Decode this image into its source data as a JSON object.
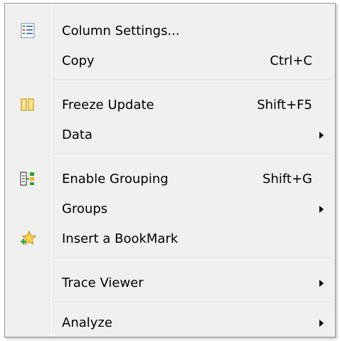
{
  "menu": {
    "items": [
      {
        "label": "Column Settings...",
        "shortcut": "",
        "icon": "column-settings-icon"
      },
      {
        "label": "Copy",
        "shortcut": "Ctrl+C"
      },
      {
        "label": "Freeze Update",
        "shortcut": "Shift+F5",
        "icon": "freeze-icon"
      },
      {
        "label": "Data",
        "shortcut": ""
      },
      {
        "label": "Enable Grouping",
        "shortcut": "Shift+G",
        "icon": "grouping-icon"
      },
      {
        "label": "Groups",
        "shortcut": ""
      },
      {
        "label": "Insert a BookMark",
        "shortcut": "",
        "icon": "bookmark-star-icon"
      },
      {
        "label": "Trace Viewer",
        "shortcut": ""
      },
      {
        "label": "Analyze",
        "shortcut": ""
      }
    ]
  },
  "colors": {
    "menu_background": "#f0f0f0",
    "border": "#979797",
    "separator": "#d7d7d7"
  }
}
